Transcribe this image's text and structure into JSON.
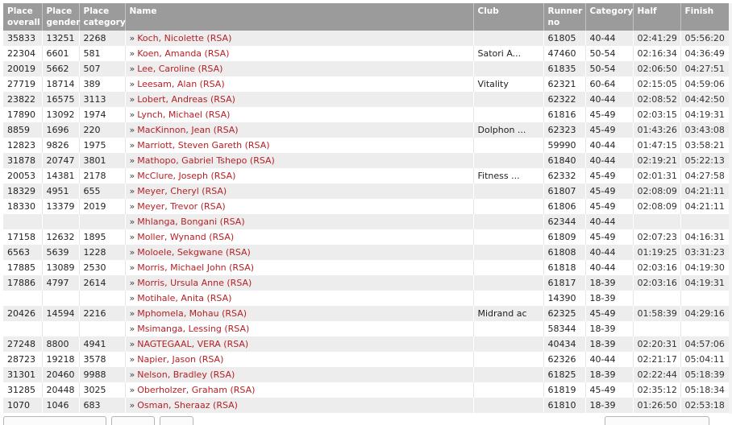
{
  "table": {
    "headers": [
      {
        "key": "overall",
        "label": "Place overall"
      },
      {
        "key": "gender",
        "label": "Place gender"
      },
      {
        "key": "category",
        "label": "Place category"
      },
      {
        "key": "name",
        "label": "Name"
      },
      {
        "key": "club",
        "label": "Club"
      },
      {
        "key": "runner",
        "label": "Runner no"
      },
      {
        "key": "cat",
        "label": "Category"
      },
      {
        "key": "half",
        "label": "Half"
      },
      {
        "key": "finish",
        "label": "Finish"
      }
    ],
    "rows": [
      {
        "overall": "35833",
        "gender": "13251",
        "category": "2268",
        "name": "Koch, Nicolette (RSA)",
        "club": "",
        "runner": "61805",
        "cat": "40-44",
        "half": "02:41:29",
        "finish": "05:56:20"
      },
      {
        "overall": "22304",
        "gender": "6601",
        "category": "581",
        "name": "Koen, Amanda (RSA)",
        "club": "Satori A...",
        "runner": "47460",
        "cat": "50-54",
        "half": "02:16:34",
        "finish": "04:36:49"
      },
      {
        "overall": "20019",
        "gender": "5662",
        "category": "507",
        "name": "Lee, Caroline (RSA)",
        "club": "",
        "runner": "61835",
        "cat": "50-54",
        "half": "02:06:50",
        "finish": "04:27:51"
      },
      {
        "overall": "27719",
        "gender": "18714",
        "category": "389",
        "name": "Leesam, Alan (RSA)",
        "club": "Vitality",
        "runner": "62321",
        "cat": "60-64",
        "half": "02:15:05",
        "finish": "04:59:06"
      },
      {
        "overall": "23822",
        "gender": "16575",
        "category": "3113",
        "name": "Lobert, Andreas (RSA)",
        "club": "",
        "runner": "62322",
        "cat": "40-44",
        "half": "02:08:52",
        "finish": "04:42:50"
      },
      {
        "overall": "17890",
        "gender": "13092",
        "category": "1974",
        "name": "Lynch, Michael (RSA)",
        "club": "",
        "runner": "61816",
        "cat": "45-49",
        "half": "02:03:15",
        "finish": "04:19:31"
      },
      {
        "overall": "8859",
        "gender": "1696",
        "category": "220",
        "name": "MacKinnon, Jean (RSA)",
        "club": "Dolphon ...",
        "runner": "62323",
        "cat": "45-49",
        "half": "01:43:26",
        "finish": "03:43:08"
      },
      {
        "overall": "12823",
        "gender": "9826",
        "category": "1975",
        "name": "Marriott, Steven Gareth (RSA)",
        "club": "",
        "runner": "59990",
        "cat": "40-44",
        "half": "01:47:15",
        "finish": "03:58:21"
      },
      {
        "overall": "31878",
        "gender": "20747",
        "category": "3801",
        "name": "Mathopo, Gabriel Tshepo (RSA)",
        "club": "",
        "runner": "61840",
        "cat": "40-44",
        "half": "02:19:21",
        "finish": "05:22:13"
      },
      {
        "overall": "20053",
        "gender": "14381",
        "category": "2178",
        "name": "McClure, Joseph (RSA)",
        "club": "Fitness ...",
        "runner": "62332",
        "cat": "45-49",
        "half": "02:01:31",
        "finish": "04:27:58"
      },
      {
        "overall": "18329",
        "gender": "4951",
        "category": "655",
        "name": "Meyer, Cheryl (RSA)",
        "club": "",
        "runner": "61807",
        "cat": "45-49",
        "half": "02:08:09",
        "finish": "04:21:11"
      },
      {
        "overall": "18330",
        "gender": "13379",
        "category": "2019",
        "name": "Meyer, Trevor (RSA)",
        "club": "",
        "runner": "61806",
        "cat": "45-49",
        "half": "02:08:09",
        "finish": "04:21:11"
      },
      {
        "overall": "",
        "gender": "",
        "category": "",
        "name": "Mhlanga, Bongani (RSA)",
        "club": "",
        "runner": "62344",
        "cat": "40-44",
        "half": "",
        "finish": ""
      },
      {
        "overall": "17158",
        "gender": "12632",
        "category": "1895",
        "name": "Moller, Wynand (RSA)",
        "club": "",
        "runner": "61809",
        "cat": "45-49",
        "half": "02:07:23",
        "finish": "04:16:31"
      },
      {
        "overall": "6563",
        "gender": "5639",
        "category": "1228",
        "name": "Moloele, Sekgwane (RSA)",
        "club": "",
        "runner": "61808",
        "cat": "40-44",
        "half": "01:19:25",
        "finish": "03:31:23"
      },
      {
        "overall": "17885",
        "gender": "13089",
        "category": "2530",
        "name": "Morris, Michael John (RSA)",
        "club": "",
        "runner": "61818",
        "cat": "40-44",
        "half": "02:03:16",
        "finish": "04:19:30"
      },
      {
        "overall": "17886",
        "gender": "4797",
        "category": "2614",
        "name": "Morris, Ursula Anne (RSA)",
        "club": "",
        "runner": "61817",
        "cat": "18-39",
        "half": "02:03:16",
        "finish": "04:19:31"
      },
      {
        "overall": "",
        "gender": "",
        "category": "",
        "name": "Motihale, Anita (RSA)",
        "club": "",
        "runner": "14390",
        "cat": "18-39",
        "half": "",
        "finish": ""
      },
      {
        "overall": "20426",
        "gender": "14594",
        "category": "2216",
        "name": "Mphomela, Mohau (RSA)",
        "club": "Midrand ac",
        "runner": "62325",
        "cat": "45-49",
        "half": "01:58:39",
        "finish": "04:29:16"
      },
      {
        "overall": "",
        "gender": "",
        "category": "",
        "name": "Msimanga, Lessing (RSA)",
        "club": "",
        "runner": "58344",
        "cat": "18-39",
        "half": "",
        "finish": ""
      },
      {
        "overall": "27248",
        "gender": "8800",
        "category": "4941",
        "name": "NAGTEGAAL, VERA (RSA)",
        "club": "",
        "runner": "40434",
        "cat": "18-39",
        "half": "02:20:31",
        "finish": "04:57:06"
      },
      {
        "overall": "28723",
        "gender": "19218",
        "category": "3578",
        "name": "Napier, Jason (RSA)",
        "club": "",
        "runner": "62326",
        "cat": "40-44",
        "half": "02:21:17",
        "finish": "05:04:11"
      },
      {
        "overall": "31301",
        "gender": "20460",
        "category": "9988",
        "name": "Nelson, Bradley (RSA)",
        "club": "",
        "runner": "61825",
        "cat": "18-39",
        "half": "02:22:44",
        "finish": "05:18:39"
      },
      {
        "overall": "31285",
        "gender": "20448",
        "category": "3025",
        "name": "Oberholzer, Graham (RSA)",
        "club": "",
        "runner": "61819",
        "cat": "45-49",
        "half": "02:35:12",
        "finish": "05:18:34"
      },
      {
        "overall": "1070",
        "gender": "1046",
        "category": "683",
        "name": "Osman, Sheraaz (RSA)",
        "club": "",
        "runner": "61810",
        "cat": "18-39",
        "half": "01:26:50",
        "finish": "02:53:18"
      }
    ]
  }
}
